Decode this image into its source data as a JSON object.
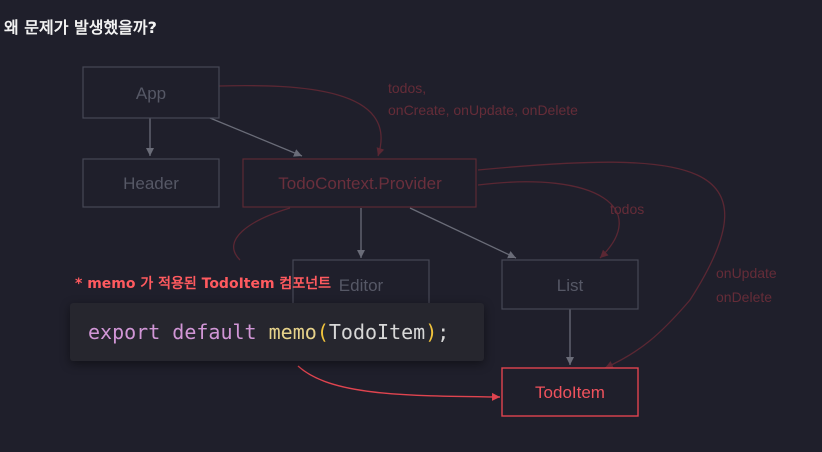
{
  "title": "왜 문제가 발생했을까?",
  "nodes": {
    "app": "App",
    "header": "Header",
    "provider": "TodoContext.Provider",
    "editor": "Editor",
    "list": "List",
    "todoitem": "TodoItem"
  },
  "edge_labels": {
    "app_to_provider_line1": "todos,",
    "app_to_provider_line2": "onCreate, onUpdate, onDelete",
    "provider_to_list": "todos",
    "provider_to_item_line1": "onUpdate",
    "provider_to_item_line2": "onDelete"
  },
  "memo_note": "* memo 가 적용된 TodoItem 컴포넌트",
  "code": {
    "export": "export",
    "default": "default",
    "memo": "memo",
    "open_paren": "(",
    "arg": "TodoItem",
    "close_paren": ")",
    "semicolon": ";"
  },
  "colors": {
    "background": "#1f1f2b",
    "highlight": "#e0444f",
    "dim_red": "#5a2733",
    "gray": "#474856"
  }
}
